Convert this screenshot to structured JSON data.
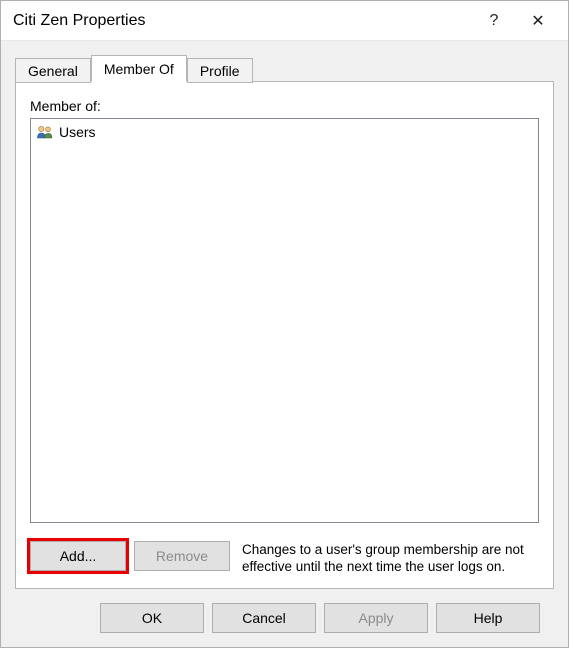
{
  "window": {
    "title": "Citi Zen Properties",
    "help_symbol": "?",
    "close_symbol": "✕"
  },
  "tabs": {
    "general": "General",
    "member_of": "Member Of",
    "profile": "Profile",
    "active_index": 1
  },
  "panel": {
    "label": "Member of:",
    "items": [
      {
        "name": "Users"
      }
    ],
    "add_label": "Add...",
    "remove_label": "Remove",
    "info_text": "Changes to a user's group membership are not effective until the next time the user logs on."
  },
  "footer": {
    "ok": "OK",
    "cancel": "Cancel",
    "apply": "Apply",
    "help": "Help"
  }
}
